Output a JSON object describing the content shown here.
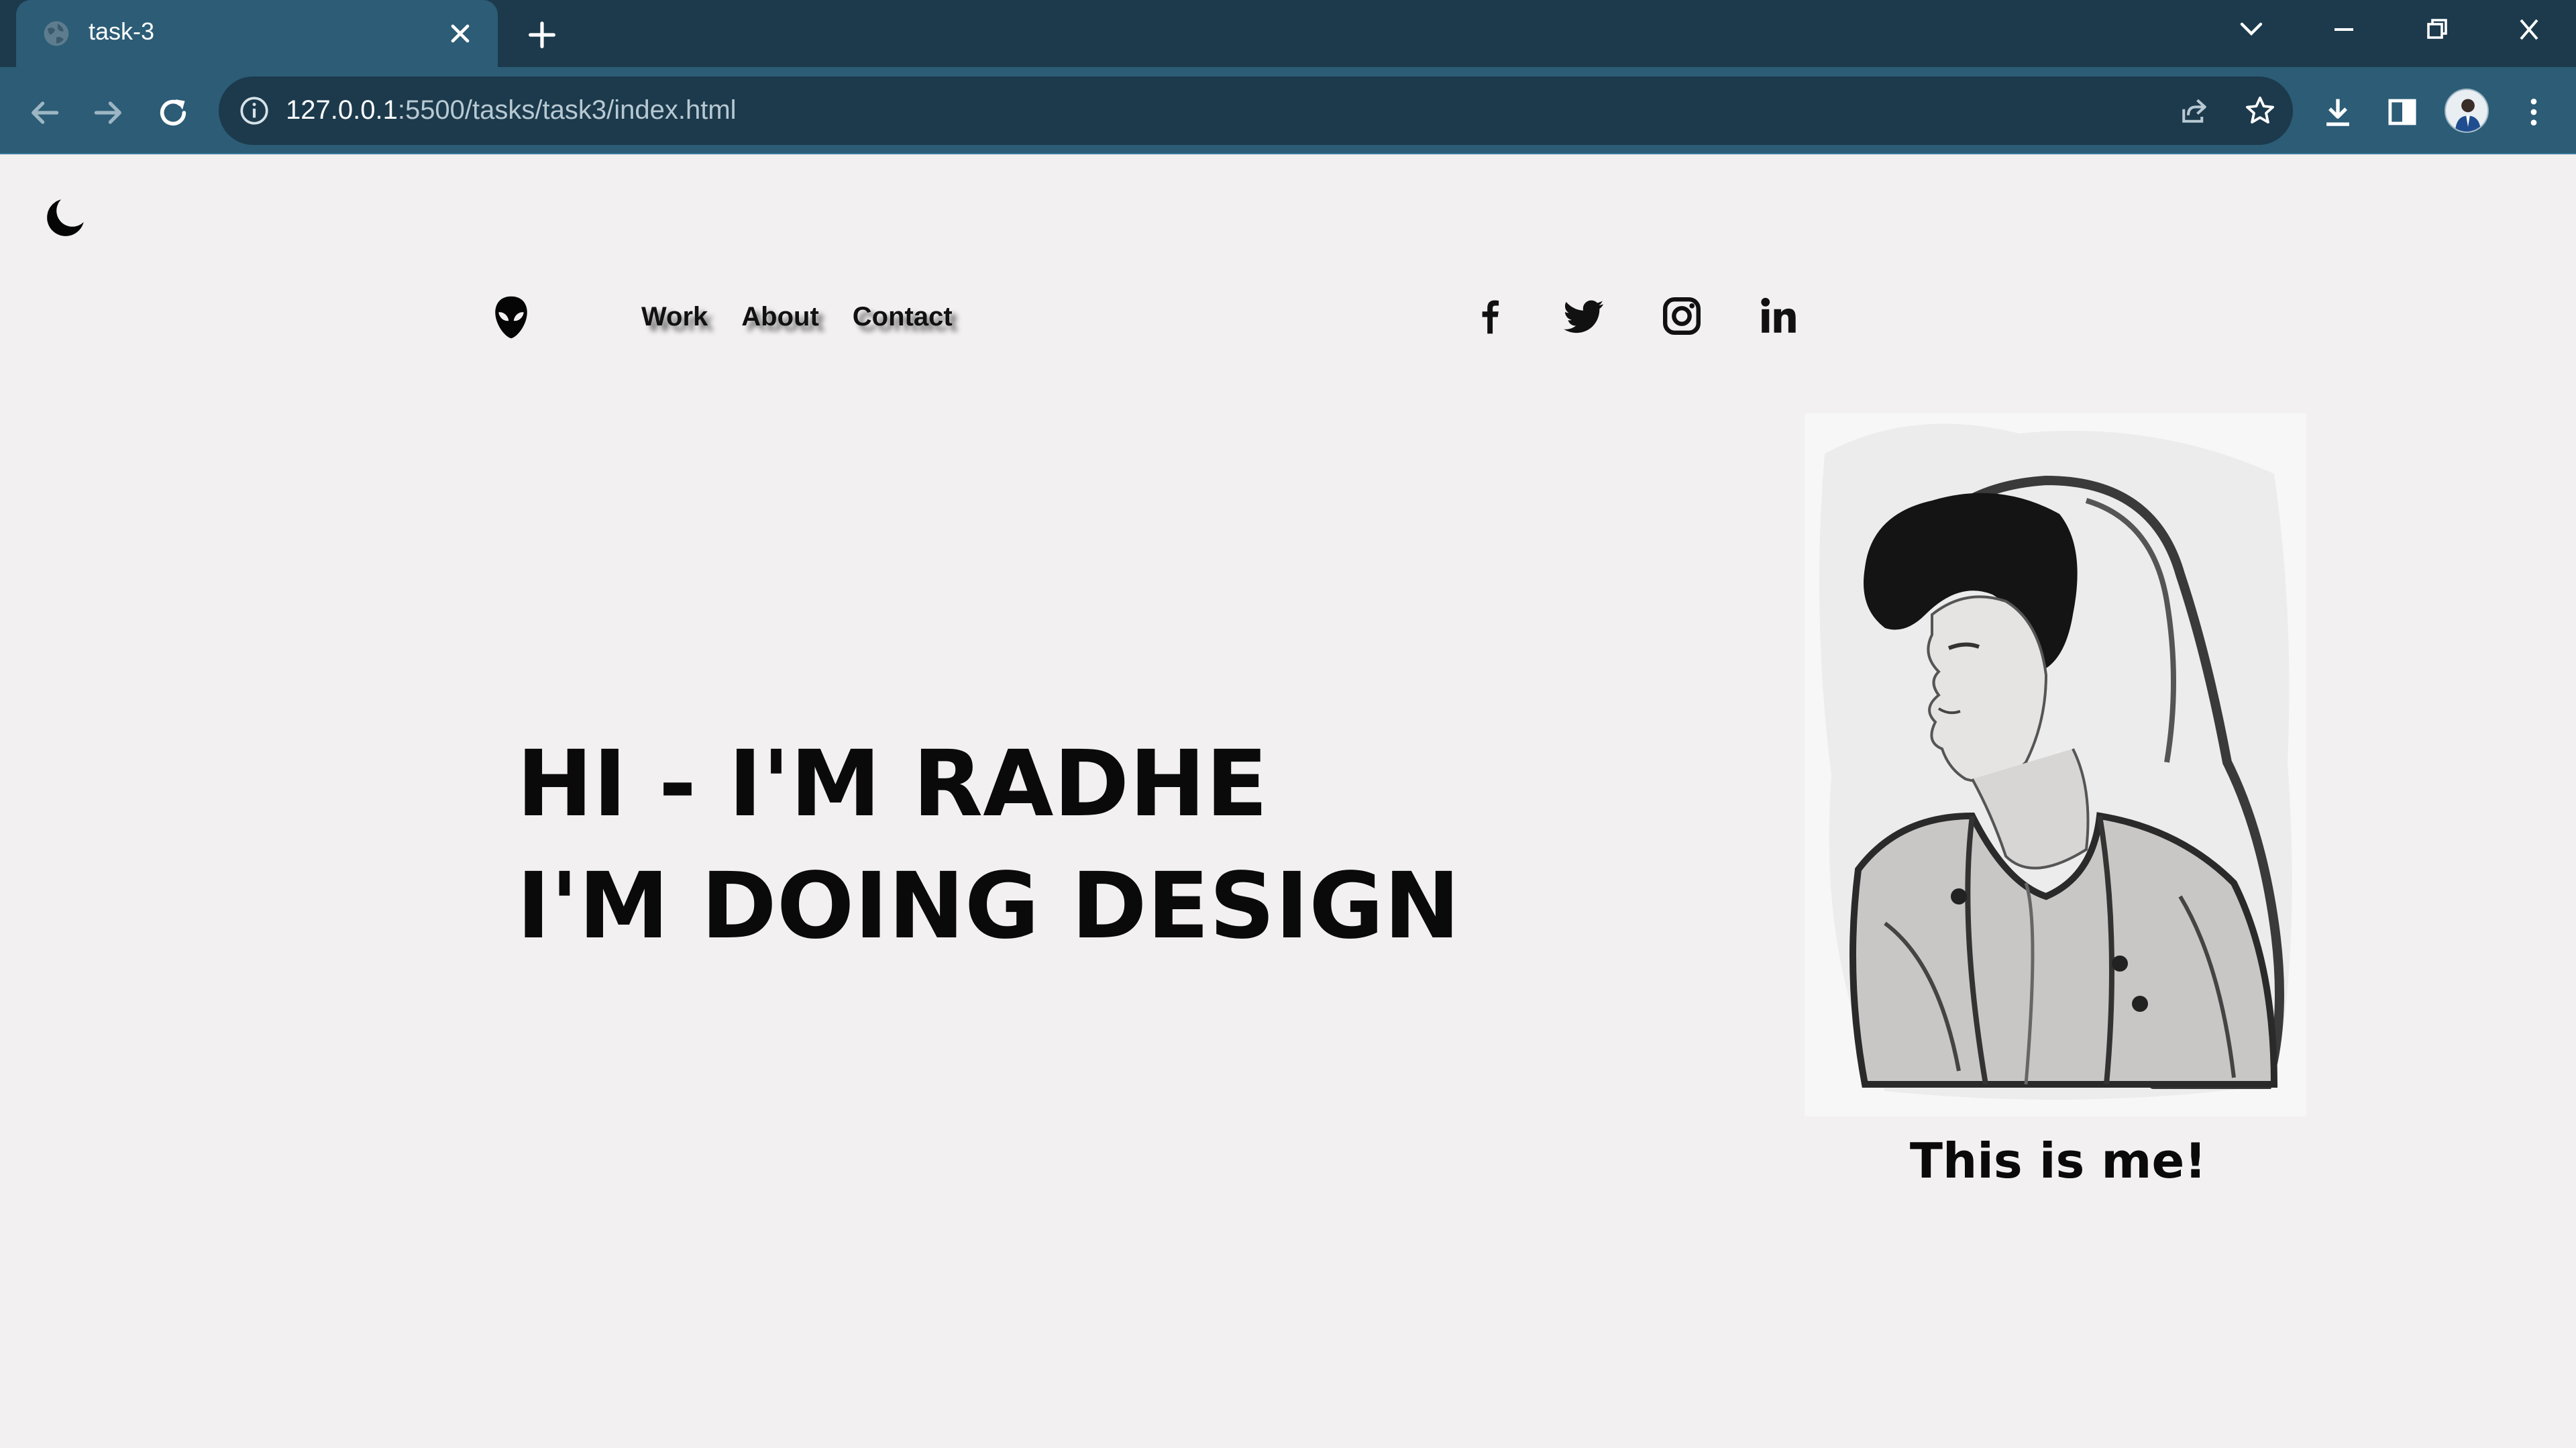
{
  "browser": {
    "tab_title": "task-3",
    "url_host": "127.0.0.1",
    "url_rest": ":5500/tasks/task3/index.html"
  },
  "colors": {
    "tabbar": "#1c3a4c",
    "toolbar": "#2c5c76",
    "page_background": "#f2f0f1",
    "text": "#0a0a0a"
  },
  "icons": {
    "favicon": "globe-icon",
    "close": "close-icon",
    "new_tab": "plus-icon",
    "tab_search": "chevron-down-icon",
    "back": "back-arrow-icon",
    "forward": "forward-arrow-icon",
    "reload": "reload-icon",
    "site_info": "info-icon",
    "share": "share-icon",
    "bookmark": "star-icon",
    "download": "download-icon",
    "side_panel": "side-panel-icon",
    "menu": "kebab-menu-icon",
    "theme": "moon-icon",
    "logo": "alien-icon",
    "facebook": "facebook-icon",
    "twitter": "twitter-icon",
    "instagram": "instagram-icon",
    "linkedin": "linkedin-icon"
  },
  "nav": {
    "items": [
      "Work",
      "About",
      "Contact"
    ]
  },
  "hero": {
    "line1": "HI - I'M RADHE",
    "line2": "I'M DOING DESIGN"
  },
  "portrait": {
    "caption": "This is me!"
  }
}
